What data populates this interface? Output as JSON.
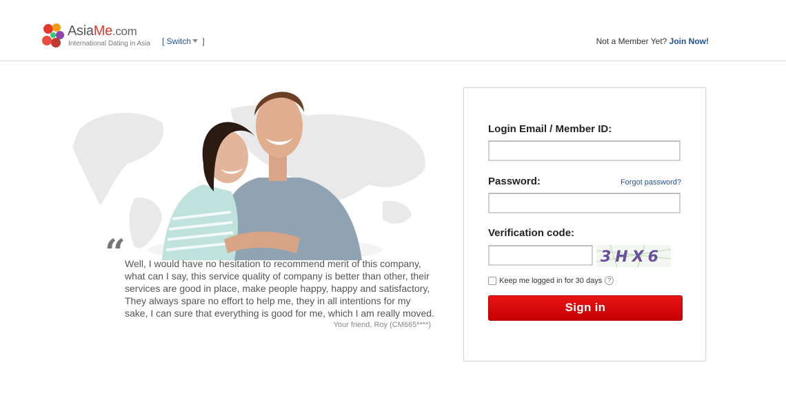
{
  "header": {
    "logo": {
      "name_prefix": "Asia",
      "name_highlight": "Me",
      "name_suffix": ".com",
      "tagline": "International Dating in Asia"
    },
    "switch": {
      "open": "[ ",
      "label": "Switch",
      "close": " ]"
    },
    "member_prompt": "Not a Member Yet?",
    "join_link": "Join Now!"
  },
  "testimonial": {
    "quote_mark": "“",
    "text": "Well, I would have no hesitation to recommend merit of this company, what can I say, this service quality of company is better than other, their services are good in place, make people happy, happy and satisfactory, They always spare no effort to help me, they in all intentions for my sake, I can sure that everything is good for me, which I am really moved.",
    "author": "Your friend, Roy (CM665****)"
  },
  "login": {
    "email_label": "Login Email / Member ID:",
    "email_value": "",
    "password_label": "Password:",
    "password_value": "",
    "forgot_link": "Forgot password?",
    "verification_label": "Verification code:",
    "verification_value": "",
    "captcha_text": "3HX6",
    "keep_logged_in": "Keep me logged in for 30 days",
    "keep_checked": false,
    "help_glyph": "?",
    "signin_button": "Sign in"
  },
  "colors": {
    "brand_red": "#e5392b",
    "link_blue": "#1f4f9a",
    "button_red": "#d10a0a"
  },
  "icons": [
    "logo-flower-icon",
    "chevron-down-icon",
    "help-icon",
    "checkbox-icon"
  ]
}
